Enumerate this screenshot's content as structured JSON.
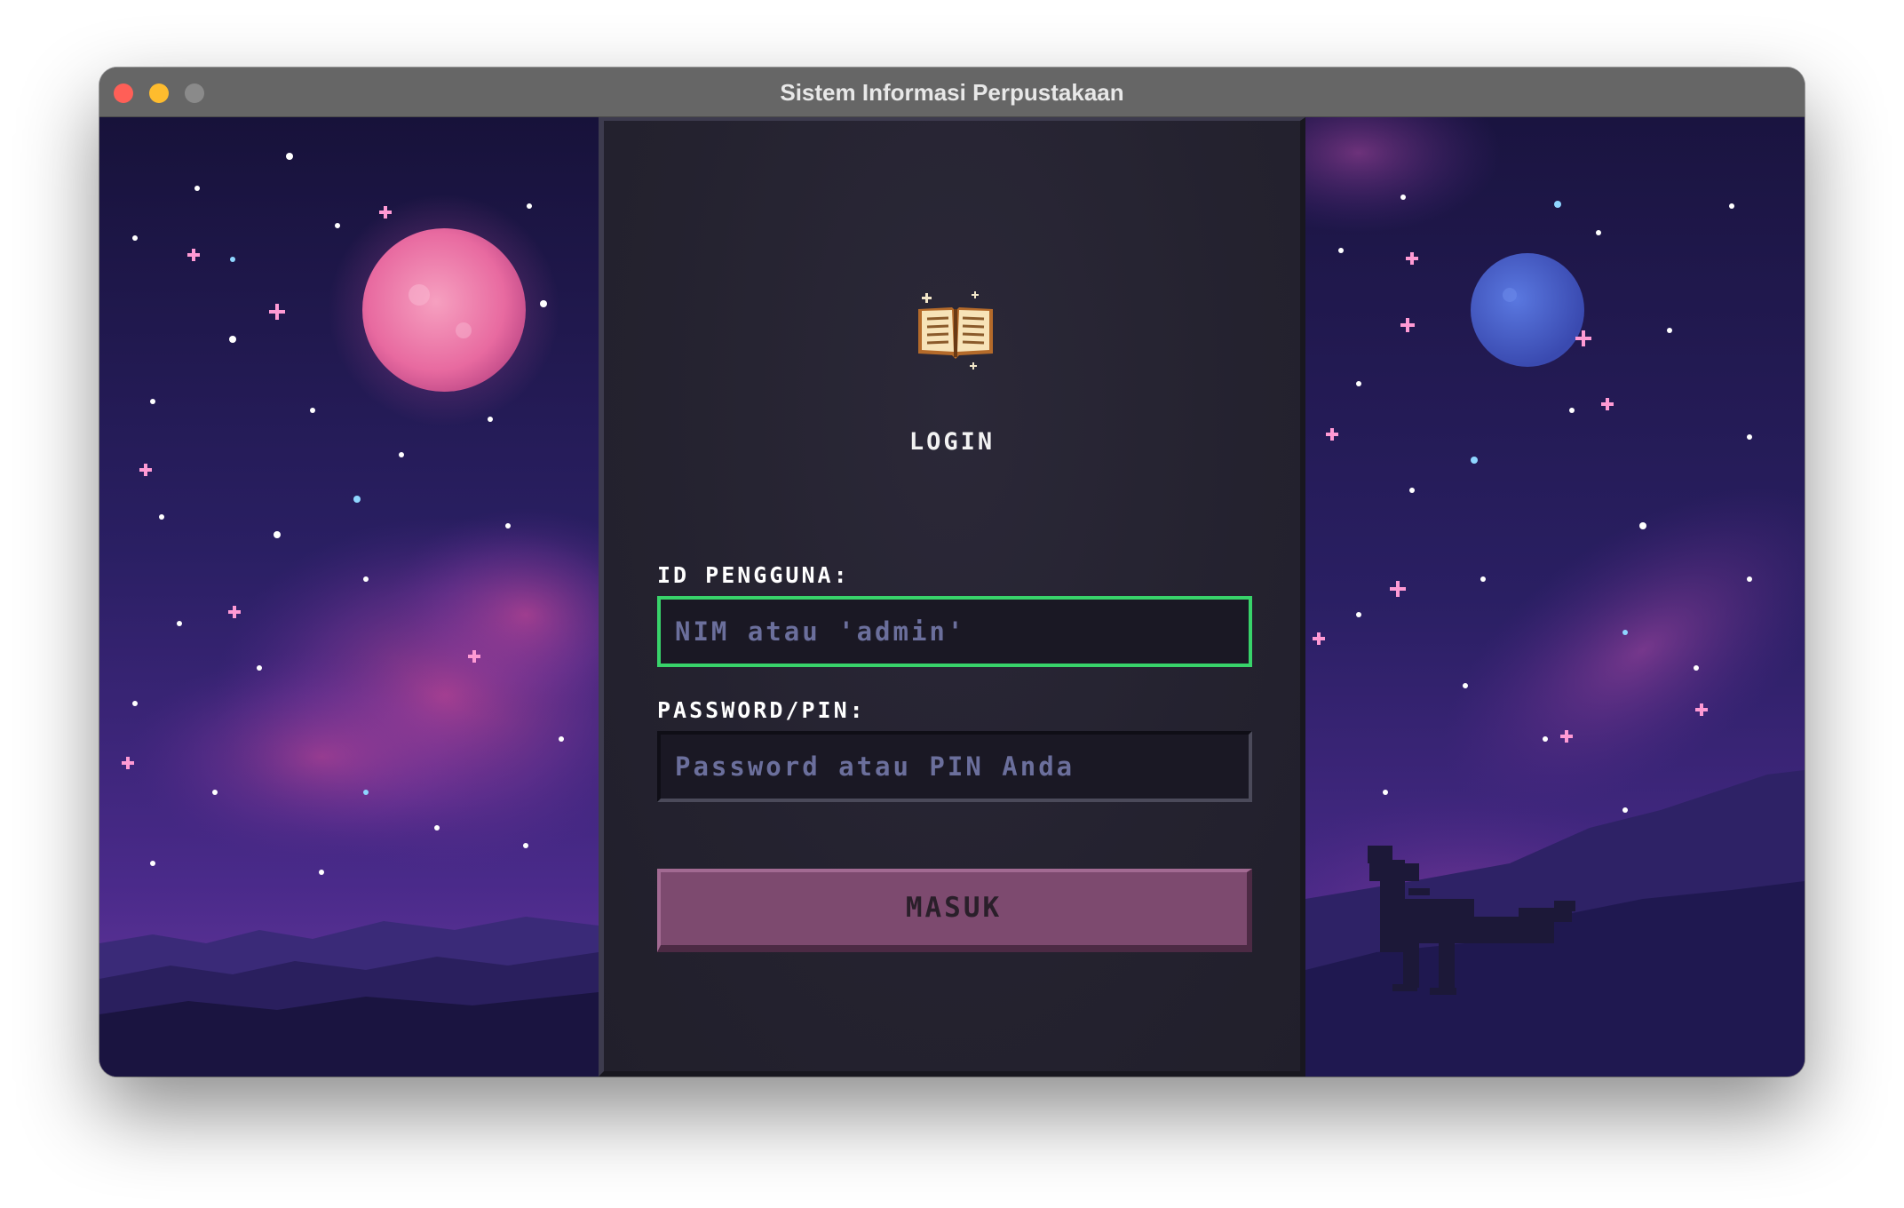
{
  "window": {
    "title": "Sistem Informasi Perpustakaan"
  },
  "login": {
    "heading": "LOGIN",
    "user_label": "ID PENGGUNA:",
    "user_placeholder": "NIM atau 'admin'",
    "user_value": "",
    "pass_label": "PASSWORD/PIN:",
    "pass_placeholder": "Password atau PIN Anda",
    "pass_value": "",
    "submit_label": "MASUK"
  },
  "icons": {
    "logo": "open-book-icon",
    "corner_button": "open-book-icon"
  },
  "colors": {
    "focus_border": "#38d36a",
    "submit_button": "#7d4a6f",
    "placeholder": "#6b6f9c",
    "panel_background": "#24222f"
  }
}
